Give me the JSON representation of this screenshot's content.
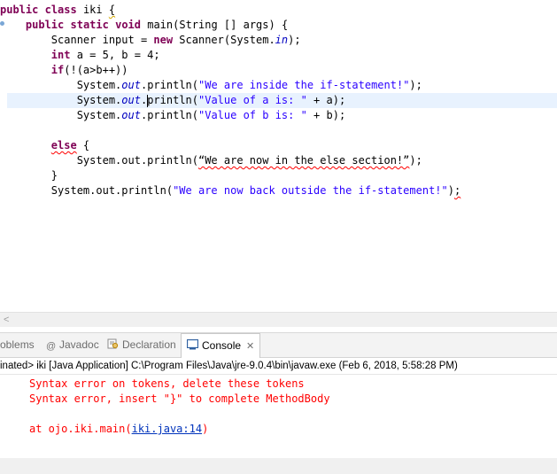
{
  "editor": {
    "lines": [
      "public class iki {",
      "    public static void main(String [] args) {",
      "        Scanner input = new Scanner(System.in);",
      "        int a = 5, b = 4;",
      "        if(!(a>b++))",
      "            System.out.println(\"We are inside the if-statement!\");",
      "            System.out.println(\"Value of a is: \" + a);",
      "            System.out.println(\"Value of b is: \" + b);",
      "",
      "        else {",
      "            System.out.println(“We are now in the else section!”);",
      "        }",
      "        System.out.println(\"We are now back outside the if-statement!\");"
    ]
  },
  "tabs": {
    "problems": "oblems",
    "javadoc": "Javadoc",
    "declaration": "Declaration",
    "console": "Console"
  },
  "console": {
    "header": "inated> iki [Java Application] C:\\Program Files\\Java\\jre-9.0.4\\bin\\javaw.exe (Feb 6, 2018, 5:58:28 PM)",
    "line1": "Syntax error on tokens, delete these tokens",
    "line2": "Syntax error, insert \"}\" to complete MethodBody",
    "at_prefix": "at ojo.iki.main(",
    "at_link": "iki.java:14",
    "at_suffix": ")"
  },
  "colors": {
    "keyword": "#7f0055",
    "string": "#2a00ff",
    "field": "#0000c0",
    "error": "#ff0000",
    "link": "#0033bb",
    "current_line": "#e8f2fe"
  }
}
